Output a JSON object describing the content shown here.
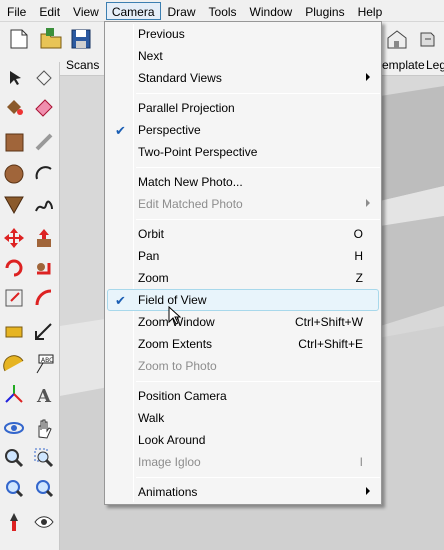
{
  "menubar": {
    "items": [
      "File",
      "Edit",
      "View",
      "Camera",
      "Draw",
      "Tools",
      "Window",
      "Plugins",
      "Help"
    ],
    "active": "Camera"
  },
  "tabs_row": {
    "scans": "Scans",
    "template": "emplate",
    "leg": "Leg"
  },
  "camera_menu": {
    "previous": "Previous",
    "next": "Next",
    "standard_views": "Standard Views",
    "parallel_projection": "Parallel Projection",
    "perspective": "Perspective",
    "two_point_perspective": "Two-Point Perspective",
    "match_new_photo": "Match New Photo...",
    "edit_matched_photo": "Edit Matched Photo",
    "orbit": "Orbit",
    "orbit_sc": "O",
    "pan": "Pan",
    "pan_sc": "H",
    "zoom": "Zoom",
    "zoom_sc": "Z",
    "field_of_view": "Field of View",
    "zoom_window": "Zoom Window",
    "zoom_window_sc": "Ctrl+Shift+W",
    "zoom_extents": "Zoom Extents",
    "zoom_extents_sc": "Ctrl+Shift+E",
    "zoom_to_photo": "Zoom to Photo",
    "position_camera": "Position Camera",
    "walk": "Walk",
    "look_around": "Look Around",
    "image_igloo": "Image Igloo",
    "image_igloo_sc": "I",
    "animations": "Animations",
    "checked": [
      "Perspective",
      "Field of View"
    ]
  },
  "colors": {
    "highlight_border": "#a8d8eb",
    "highlight_fill": "#e8f4fb",
    "check": "#1a5eb4",
    "disabled_text": "#8d8d8d"
  }
}
